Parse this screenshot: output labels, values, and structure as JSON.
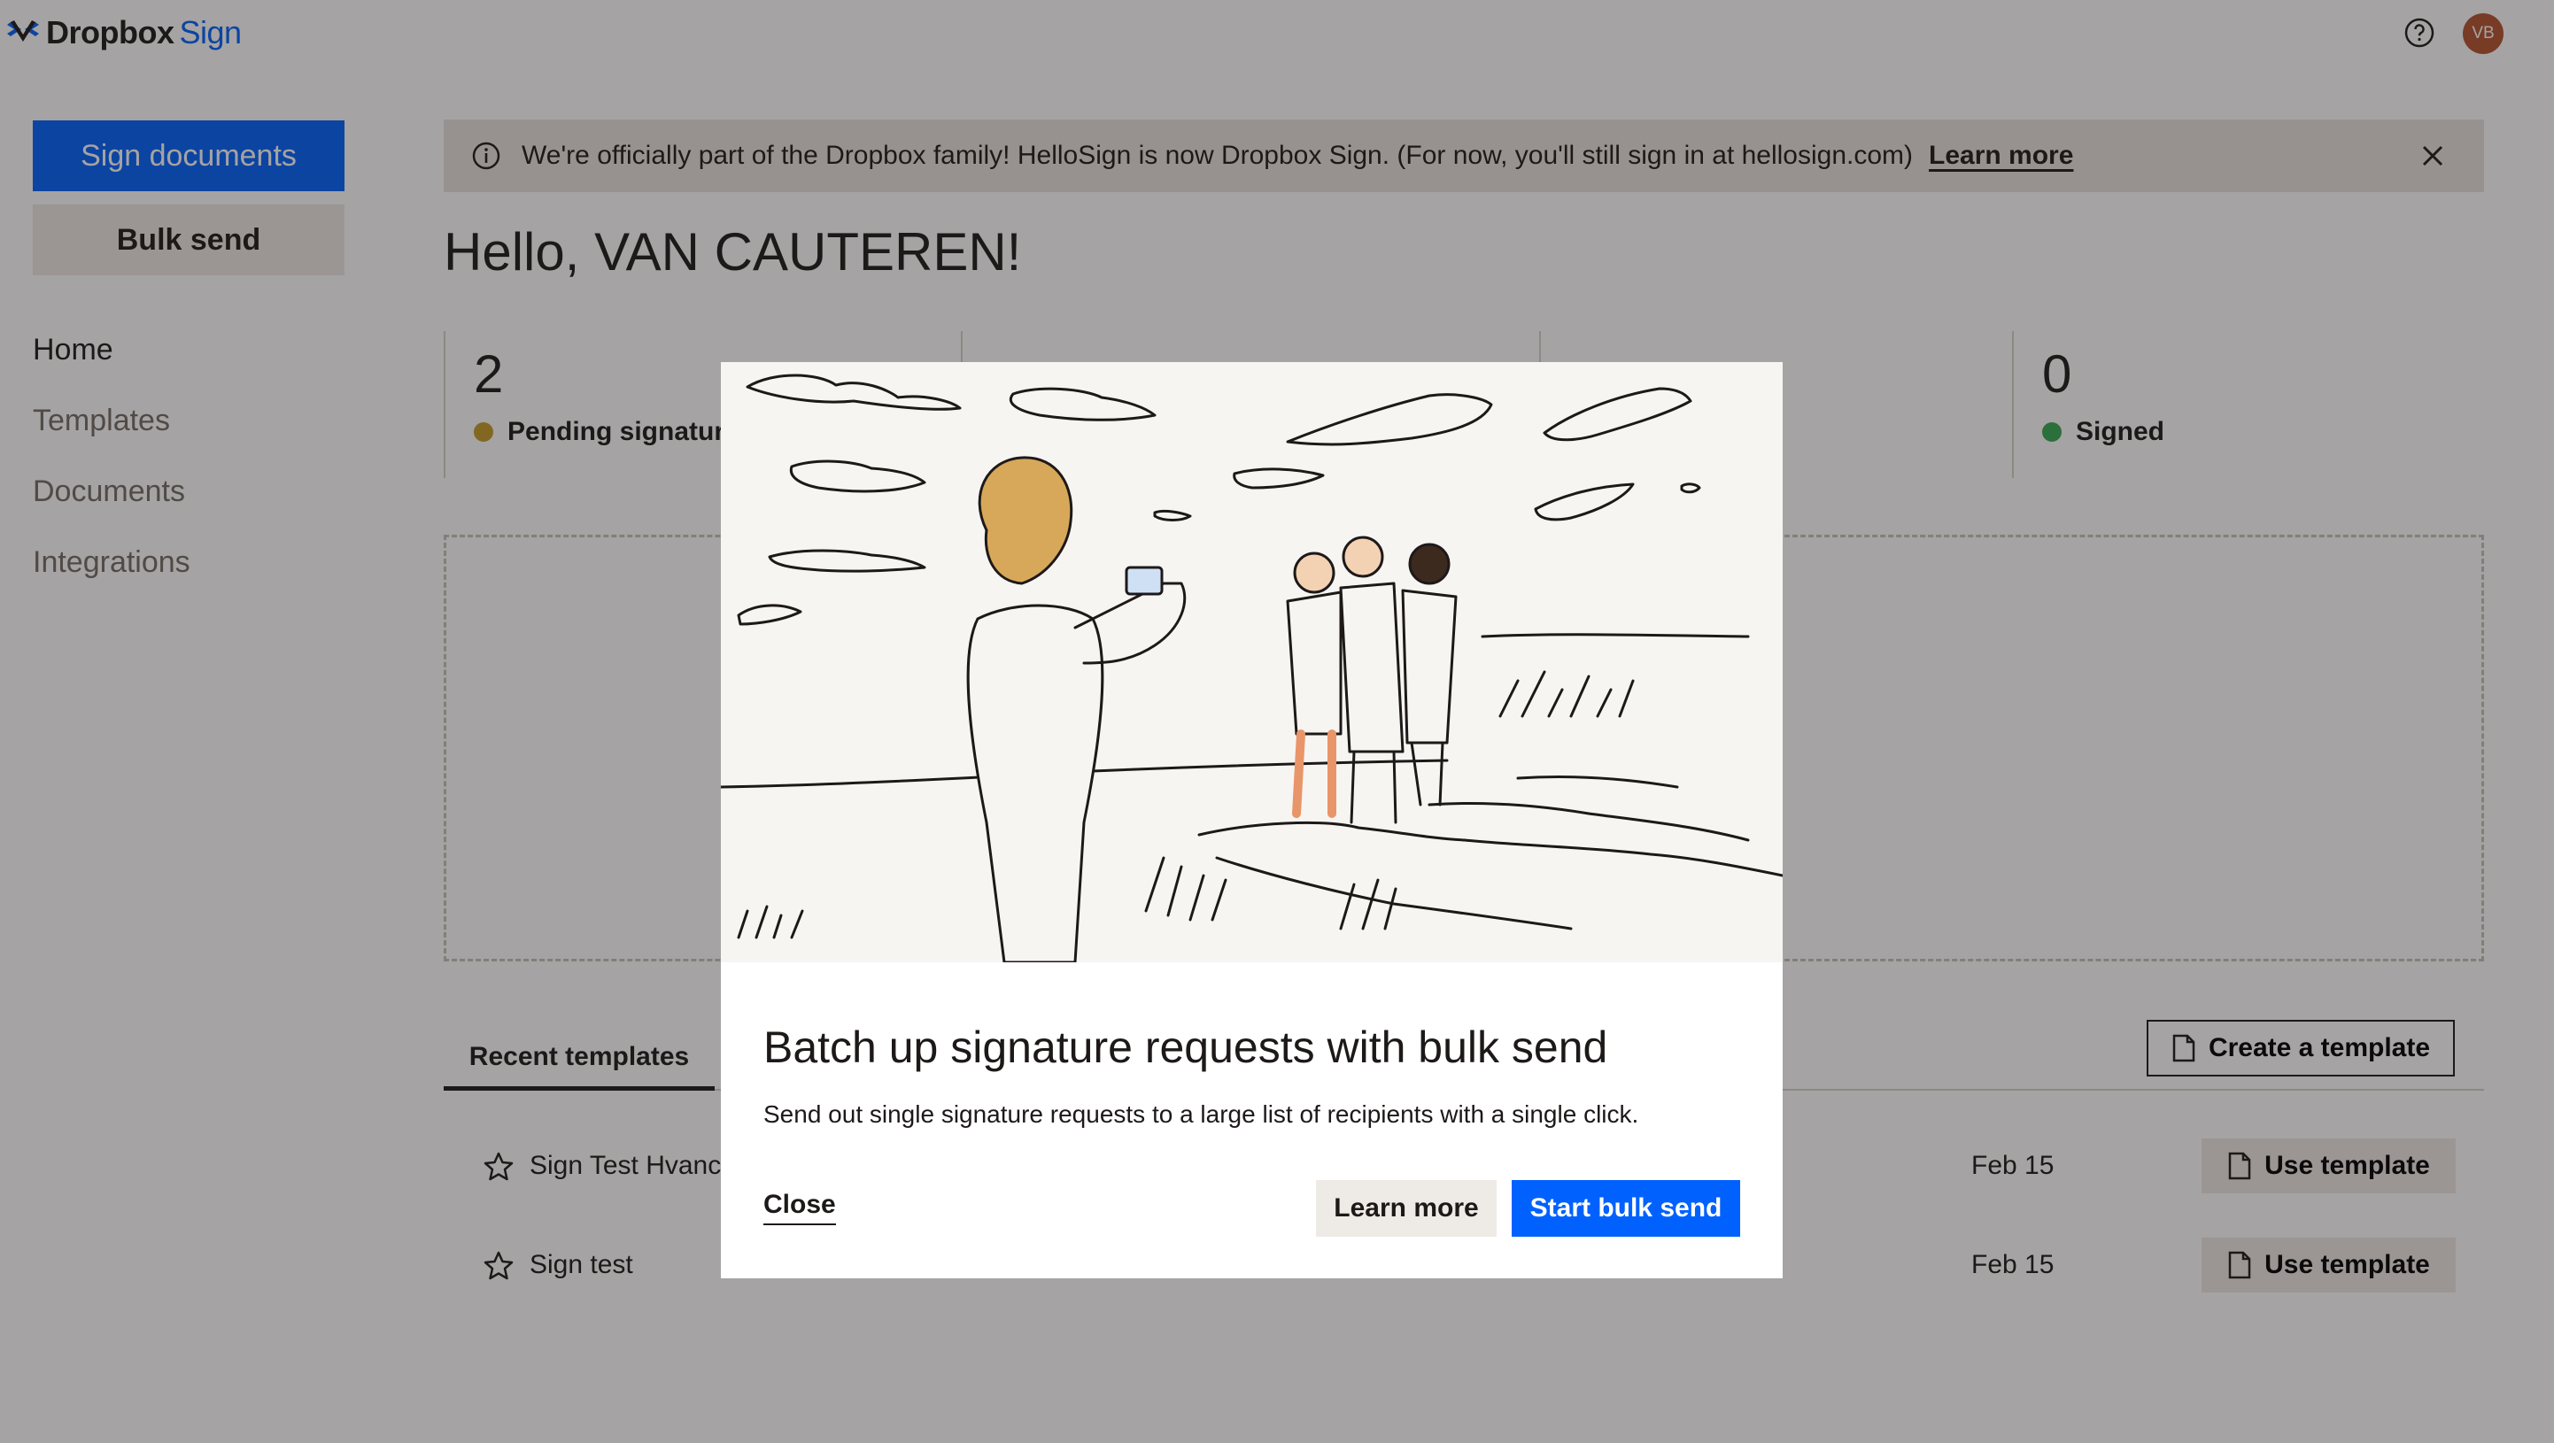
{
  "app": {
    "brand": "Dropbox",
    "brand_suffix": "Sign"
  },
  "header": {
    "avatar_initials": "VB"
  },
  "sidebar": {
    "primary_button": "Sign documents",
    "secondary_button": "Bulk send",
    "nav": [
      "Home",
      "Templates",
      "Documents",
      "Integrations"
    ]
  },
  "banner": {
    "text": "We're officially part of the Dropbox family! HelloSign is now Dropbox Sign. (For now, you'll still sign in at hellosign.com)",
    "link": "Learn more"
  },
  "greeting": "Hello, VAN CAUTEREN!",
  "stats": [
    {
      "count": "2",
      "label": "Pending signature",
      "color": "#c59b2a"
    },
    {
      "count": "0",
      "label": "Signed",
      "color": "#35a853"
    }
  ],
  "templates": {
    "tab": "Recent templates",
    "create_button": "Create a template",
    "rows": [
      {
        "title": "Sign Test Hvanc",
        "date": "Feb 15",
        "action": "Use template"
      },
      {
        "title": "Sign test",
        "date": "Feb 15",
        "action": "Use template"
      }
    ]
  },
  "modal": {
    "title": "Batch up signature requests with bulk send",
    "description": "Send out single signature requests to a large list of recipients with a single click.",
    "close": "Close",
    "learn_more": "Learn more",
    "primary": "Start bulk send"
  },
  "colors": {
    "accent": "#0061fe",
    "avatar": "#b4532f"
  },
  "icons": [
    "dropbox-logo-icon",
    "help-icon",
    "info-icon",
    "close-icon",
    "star-icon",
    "document-icon"
  ]
}
